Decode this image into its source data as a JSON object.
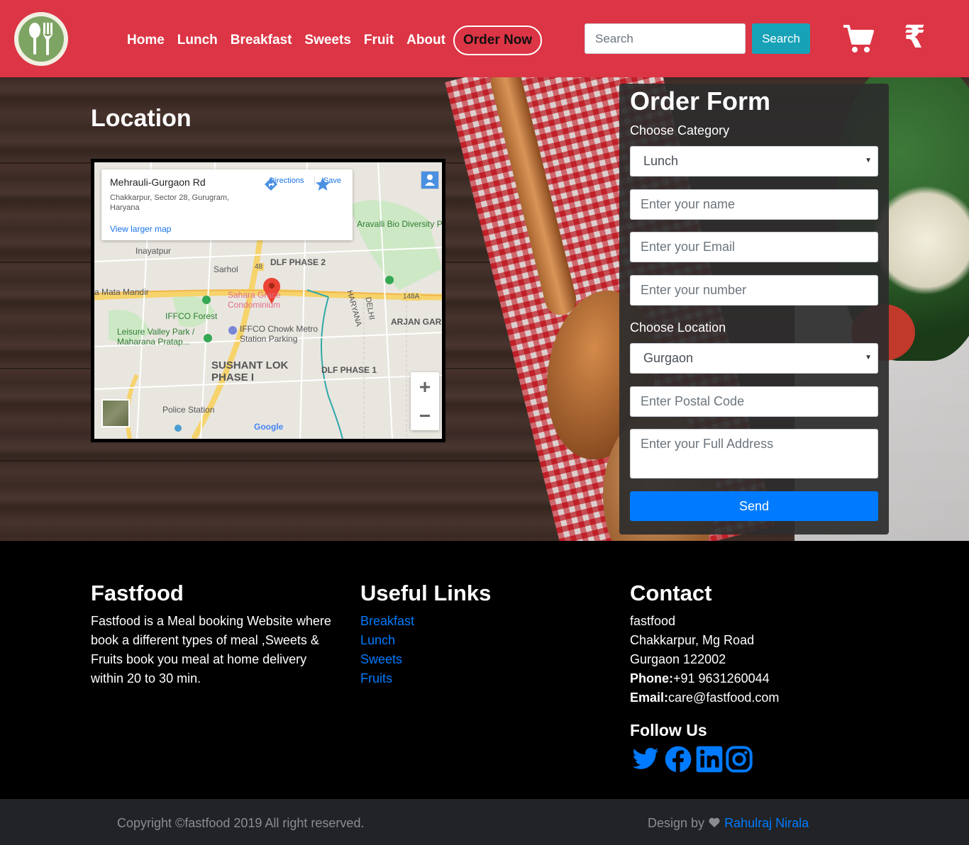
{
  "nav": {
    "links": [
      "Home",
      "Lunch",
      "Breakfast",
      "Sweets",
      "Fruit",
      "About"
    ],
    "order_now": "Order Now",
    "search_placeholder": "Search",
    "search_button": "Search",
    "currency_symbol": "₹",
    "brand_color": "#dc3545"
  },
  "location": {
    "title": "Location",
    "map": {
      "card_title": "Mehrauli-Gurgaon Rd",
      "card_address": "Chakkarpur, Sector 28, Gurugram, Haryana",
      "view_larger": "View larger map",
      "directions": "Directions",
      "save": "Save",
      "labels": [
        "Aravalli Bio Diversity Park",
        "Inayatpur",
        "Sarhol",
        "a Mata Mandir",
        "DLF PHASE 2",
        "Sahara Grace Condominium",
        "IFFCO Forest",
        "IFFCO Chowk Metro Station Parking",
        "Leisure Valley Park / Maharana Pratap...",
        "ARJAN GAR",
        "SUSHANT LOK PHASE I",
        "DLF PHASE 1",
        "Police Station",
        "Google",
        "HARYANA",
        "DELHI",
        "148A",
        "48"
      ]
    }
  },
  "order_form": {
    "title": "Order Form",
    "category_label": "Choose Category",
    "category_value": "Lunch",
    "name_placeholder": "Enter your name",
    "email_placeholder": "Enter your Email",
    "number_placeholder": "Enter your number",
    "location_label": "Choose Location",
    "location_value": "Gurgaon",
    "postal_placeholder": "Enter Postal Code",
    "address_placeholder": "Enter your Full Address",
    "send": "Send"
  },
  "footer": {
    "about": {
      "title": "Fastfood",
      "text": "Fastfood is a Meal booking Website where book a different types of meal ,Sweets & Fruits book you meal at home delivery within 20 to 30 min."
    },
    "links": {
      "title": "Useful Links",
      "items": [
        "Breakfast",
        "Lunch",
        "Sweets",
        "Fruits"
      ]
    },
    "contact": {
      "title": "Contact",
      "name": "fastfood",
      "street": "Chakkarpur, Mg Road",
      "city": "Gurgaon 122002",
      "phone_label": "Phone:",
      "phone": "+91 9631260044",
      "email_label": "Email:",
      "email": "care@fastfood.com",
      "follow": "Follow Us",
      "social_icons": [
        "twitter-icon",
        "facebook-icon",
        "linkedin-icon",
        "instagram-icon"
      ]
    }
  },
  "copyright": {
    "text": "Copyright ©fastfood 2019 All right reserved.",
    "design_by": "Design by",
    "author": "Rahulraj Nirala"
  }
}
